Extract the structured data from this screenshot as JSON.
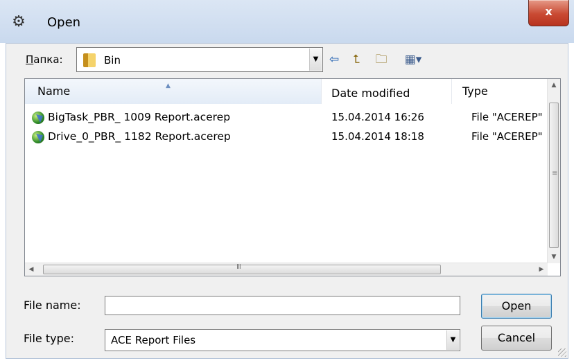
{
  "window": {
    "title": "Open",
    "close_label": "x"
  },
  "toolbar": {
    "look_in_label_accel": "П",
    "look_in_label_rest": "апка:",
    "current_folder": "Bin",
    "icons": [
      "back-arrow-icon",
      "up-folder-icon",
      "new-folder-icon",
      "view-menu-icon"
    ]
  },
  "list": {
    "columns": [
      "Name",
      "Date modified",
      "Type"
    ],
    "sort_column": "Name",
    "files": [
      {
        "name": "BigTask_PBR_ 1009 Report.acerep",
        "date": "15.04.2014 16:26",
        "type": "File  \"ACEREP\""
      },
      {
        "name": "Drive_0_PBR_ 1182 Report.acerep",
        "date": "15.04.2014 18:18",
        "type": "File  \"ACEREP\""
      }
    ],
    "hscroll_grip": "III"
  },
  "form": {
    "file_name_label": "File name:",
    "file_name_value": "",
    "file_type_label": "File type:",
    "file_type_value": "ACE Report Files"
  },
  "buttons": {
    "open": "Open",
    "cancel": "Cancel"
  },
  "colors": {
    "titlebar": "#c9d9ee",
    "close_button": "#c94a33",
    "client_bg": "#f0f0f0"
  }
}
